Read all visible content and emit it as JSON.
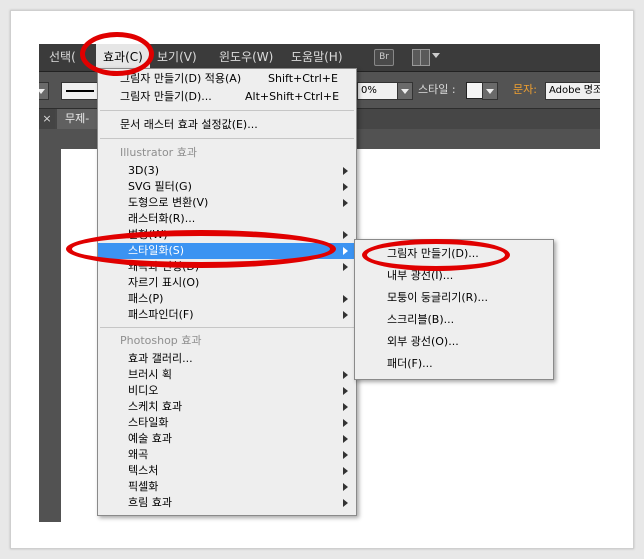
{
  "menubar": {
    "items": [
      "선택(",
      "효과(C)",
      "보기(V)",
      "윈도우(W)",
      "도움말(H)"
    ],
    "bridge_badge": "Br"
  },
  "controlbar": {
    "opacity_value": "0%",
    "style_label": "스타일 :",
    "char_label": "문자:",
    "font_value": "Adobe 명조"
  },
  "doc_tab": {
    "close": "×",
    "title": "무제-"
  },
  "effect_menu": {
    "items": [
      {
        "label": "그림자 만들기(D) 적용(A)",
        "shortcut": "Shift+Ctrl+E"
      },
      {
        "label": "그림자 만들기(D)...",
        "shortcut": "Alt+Shift+Ctrl+E"
      },
      {
        "label": "문서 래스터 효과 설정값(E)..."
      },
      {
        "label": "Illustrator 효과",
        "header": true
      },
      {
        "label": "3D(3)",
        "submenu": true
      },
      {
        "label": "SVG 필터(G)",
        "submenu": true
      },
      {
        "label": "도형으로 변환(V)",
        "submenu": true
      },
      {
        "label": "래스터화(R)..."
      },
      {
        "label": "변형(W)",
        "submenu": true
      },
      {
        "label": "스타일화(S)",
        "submenu": true,
        "highlighted": true
      },
      {
        "label": "왜곡과 변형(D)",
        "submenu": true
      },
      {
        "label": "자르기 표시(O)"
      },
      {
        "label": "패스(P)",
        "submenu": true
      },
      {
        "label": "패스파인더(F)",
        "submenu": true
      },
      {
        "label": "Photoshop 효과",
        "header": true
      },
      {
        "label": "효과 갤러리..."
      },
      {
        "label": "브러시 획",
        "submenu": true
      },
      {
        "label": "비디오",
        "submenu": true
      },
      {
        "label": "스케치 효과",
        "submenu": true
      },
      {
        "label": "스타일화",
        "submenu": true
      },
      {
        "label": "예술 효과",
        "submenu": true
      },
      {
        "label": "왜곡",
        "submenu": true
      },
      {
        "label": "텍스처",
        "submenu": true
      },
      {
        "label": "픽셀화",
        "submenu": true
      },
      {
        "label": "흐림 효과",
        "submenu": true
      }
    ]
  },
  "stylize_submenu": {
    "items": [
      {
        "label": "그림자 만들기(D)..."
      },
      {
        "label": "내부 광선(I)..."
      },
      {
        "label": "모퉁이 둥글리기(R)..."
      },
      {
        "label": "스크리블(B)..."
      },
      {
        "label": "외부 광선(O)..."
      },
      {
        "label": "패더(F)..."
      }
    ]
  },
  "colors": {
    "highlight": "#3b93f2",
    "annotation": "#e00000",
    "char_label": "#f0a030"
  }
}
